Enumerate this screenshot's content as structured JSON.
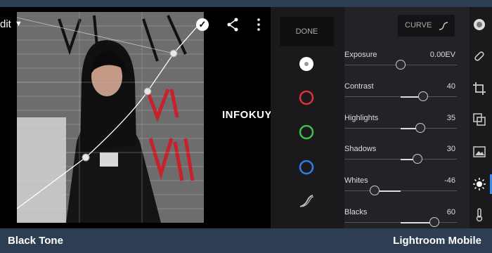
{
  "header": {
    "edit_label": "dit"
  },
  "watermark": "INFOKUY.NET",
  "tools_panel": {
    "done_label": "DONE"
  },
  "curve_button": {
    "label": "CURVE"
  },
  "sliders": [
    {
      "label": "Exposure",
      "value": "0.00EV",
      "position": 0.5
    },
    {
      "label": "Contrast",
      "value": "40",
      "position": 0.7
    },
    {
      "label": "Highlights",
      "value": "35",
      "position": 0.675
    },
    {
      "label": "Shadows",
      "value": "30",
      "position": 0.65
    },
    {
      "label": "Whites",
      "value": "-46",
      "position": 0.27
    },
    {
      "label": "Blacks",
      "value": "60",
      "position": 0.8
    }
  ],
  "footer": {
    "left": "Black Tone",
    "right": "Lightroom Mobile"
  },
  "colors": {
    "accent": "#3a8df5",
    "red_channel": "#e0303a",
    "green_channel": "#3ec24a",
    "blue_channel": "#2f7de0"
  }
}
